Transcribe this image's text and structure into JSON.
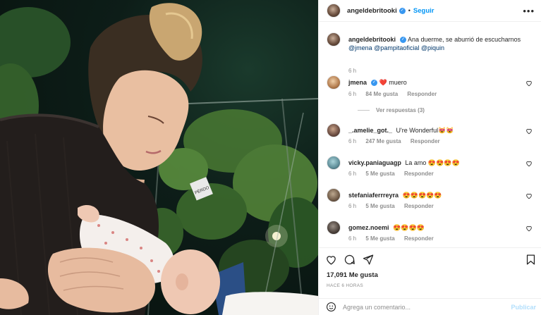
{
  "post": {
    "author": "angeldebritooki",
    "follow_label": "Seguir",
    "more_label": "•••",
    "caption_text": "Ana duerme, se aburrió de escucharnos",
    "caption_mentions": [
      "@jmena",
      "@pampitaoficial",
      "@piquin"
    ],
    "caption_time": "6 h",
    "photo_sign_text": "PÉRDO"
  },
  "comments": [
    {
      "user": "jmena",
      "verified": true,
      "text": "❤️ muero",
      "time": "6 h",
      "likes": "84 Me gusta",
      "reply": "Responder",
      "replies_label": "Ver respuestas (3)"
    },
    {
      "user": "_.amelie_got._",
      "verified": false,
      "text": "U're Wonderful😻😻",
      "time": "6 h",
      "likes": "247 Me gusta",
      "reply": "Responder"
    },
    {
      "user": "vicky.paniaguagp",
      "verified": false,
      "text": "La amo 😍😍😍😍",
      "time": "6 h",
      "likes": "5 Me gusta",
      "reply": "Responder"
    },
    {
      "user": "stefaniaferrreyra",
      "verified": false,
      "text": "😍😍😍😍😍",
      "time": "6 h",
      "likes": "5 Me gusta",
      "reply": "Responder"
    },
    {
      "user": "gomez.noemi",
      "verified": false,
      "text": "😍😍😍😍",
      "time": "6 h",
      "likes": "5 Me gusta",
      "reply": "Responder"
    }
  ],
  "footer": {
    "likes_count": "17,091 Me gusta",
    "time_ago": "HACE 6 HORAS",
    "comment_placeholder": "Agrega un comentario...",
    "publish_label": "Publicar"
  },
  "colors": {
    "accent": "#0095f6",
    "verified": "#3897f0",
    "heart": "#ed4956",
    "muted": "#8e8e8e",
    "publish_disabled": "#b2dffc"
  },
  "icons": [
    "verified-icon",
    "heart-icon",
    "comment-icon",
    "share-icon",
    "bookmark-icon",
    "emoji-icon",
    "more-icon"
  ]
}
